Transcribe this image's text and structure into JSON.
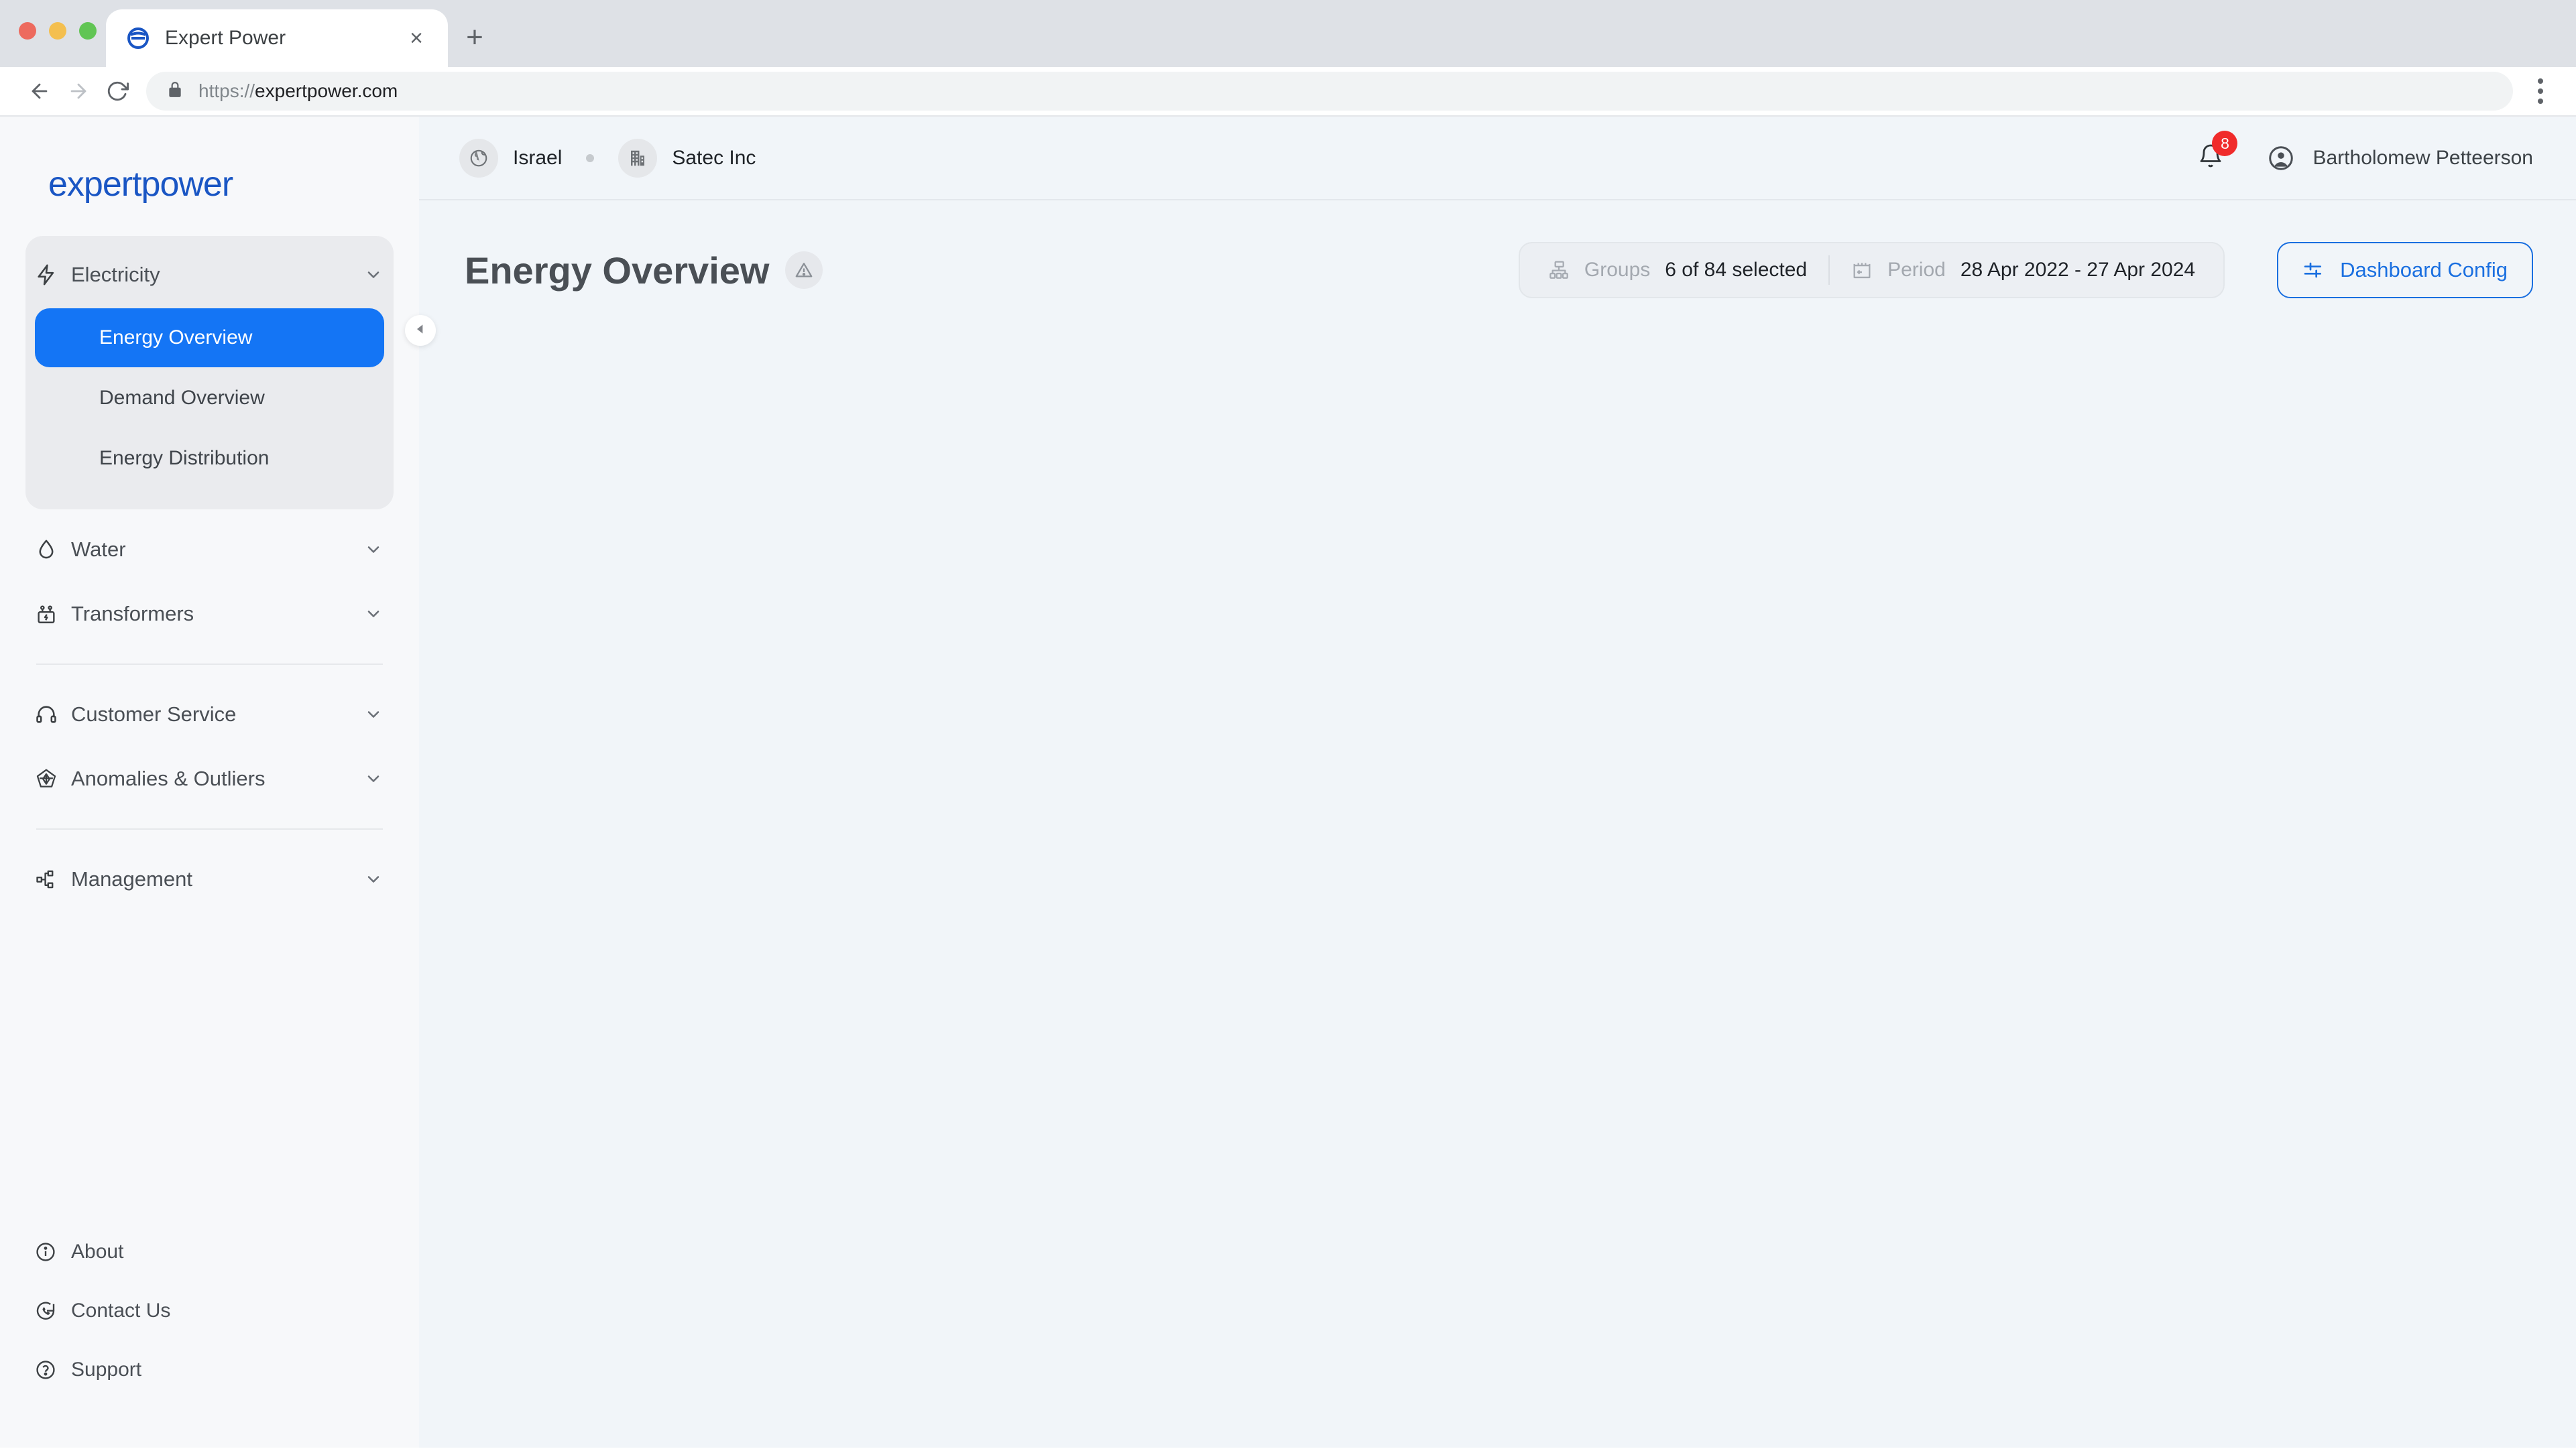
{
  "browser": {
    "tab": {
      "title": "Expert Power",
      "favicon": "expertpower-favicon",
      "close_label": "×"
    },
    "newtab_label": "+",
    "address": {
      "scheme": "https://",
      "host": "expertpower.com",
      "full": "https://expertpower.com"
    },
    "nav": {
      "back": "back-arrow",
      "forward": "forward-arrow",
      "reload": "reload-icon"
    },
    "menu": "browser-menu-kebab"
  },
  "sidebar": {
    "logo_text": "expertpower",
    "collapse_label": "collapse-sidebar",
    "groups": [
      {
        "id": "electricity",
        "label": "Electricity",
        "icon": "lightning-bolt-icon",
        "expanded": true,
        "chevron": "chevron-down-icon",
        "items": [
          {
            "label": "Energy Overview",
            "selected": true
          },
          {
            "label": "Demand Overview",
            "selected": false
          },
          {
            "label": "Energy Distribution",
            "selected": false
          }
        ]
      },
      {
        "id": "water",
        "label": "Water",
        "icon": "water-drop-icon",
        "expanded": false,
        "chevron": "chevron-down-icon",
        "items": []
      },
      {
        "id": "transformers",
        "label": "Transformers",
        "icon": "transformer-icon",
        "expanded": false,
        "chevron": "chevron-down-icon",
        "items": []
      },
      {
        "id": "customer-service",
        "label": "Customer Service",
        "icon": "headset-icon",
        "expanded": false,
        "chevron": "chevron-down-icon",
        "items": []
      },
      {
        "id": "anomalies",
        "label": "Anomalies & Outliers",
        "icon": "pentagon-star-icon",
        "expanded": false,
        "chevron": "chevron-down-icon",
        "items": []
      },
      {
        "id": "management",
        "label": "Management",
        "icon": "org-nodes-icon",
        "expanded": false,
        "chevron": "chevron-down-icon",
        "items": []
      }
    ],
    "bottom_items": [
      {
        "label": "About",
        "icon": "info-circle-icon"
      },
      {
        "label": "Contact Us",
        "icon": "phone-chat-icon"
      },
      {
        "label": "Support",
        "icon": "question-circle-icon"
      }
    ]
  },
  "topbar": {
    "breadcrumbs": [
      {
        "label": "Israel",
        "icon": "globe-icon"
      },
      {
        "label": "Satec Inc",
        "icon": "building-icon"
      }
    ],
    "notifications": {
      "icon": "bell-icon",
      "count": "8"
    },
    "user": {
      "name": "Bartholomew Petteerson",
      "avatar": "user-avatar-icon"
    }
  },
  "page": {
    "title": "Energy Overview",
    "warning_icon": "warning-triangle-icon",
    "filters": {
      "groups": {
        "icon": "groups-hierarchy-icon",
        "key": "Groups",
        "value": "6 of 84 selected"
      },
      "period": {
        "icon": "calendar-period-icon",
        "key": "Period",
        "value": "28 Apr 2022 - 27 Apr 2024"
      }
    },
    "dashboard_config": {
      "icon": "sliders-icon",
      "label": "Dashboard Config"
    }
  },
  "colors": {
    "accent_blue": "#1475f5",
    "link_blue": "#1a6fe0",
    "badge_red": "#f02b2b",
    "sidebar_bg": "#f7f8fa",
    "content_bg": "#f1f5f9",
    "group_bg": "#eaebee"
  }
}
